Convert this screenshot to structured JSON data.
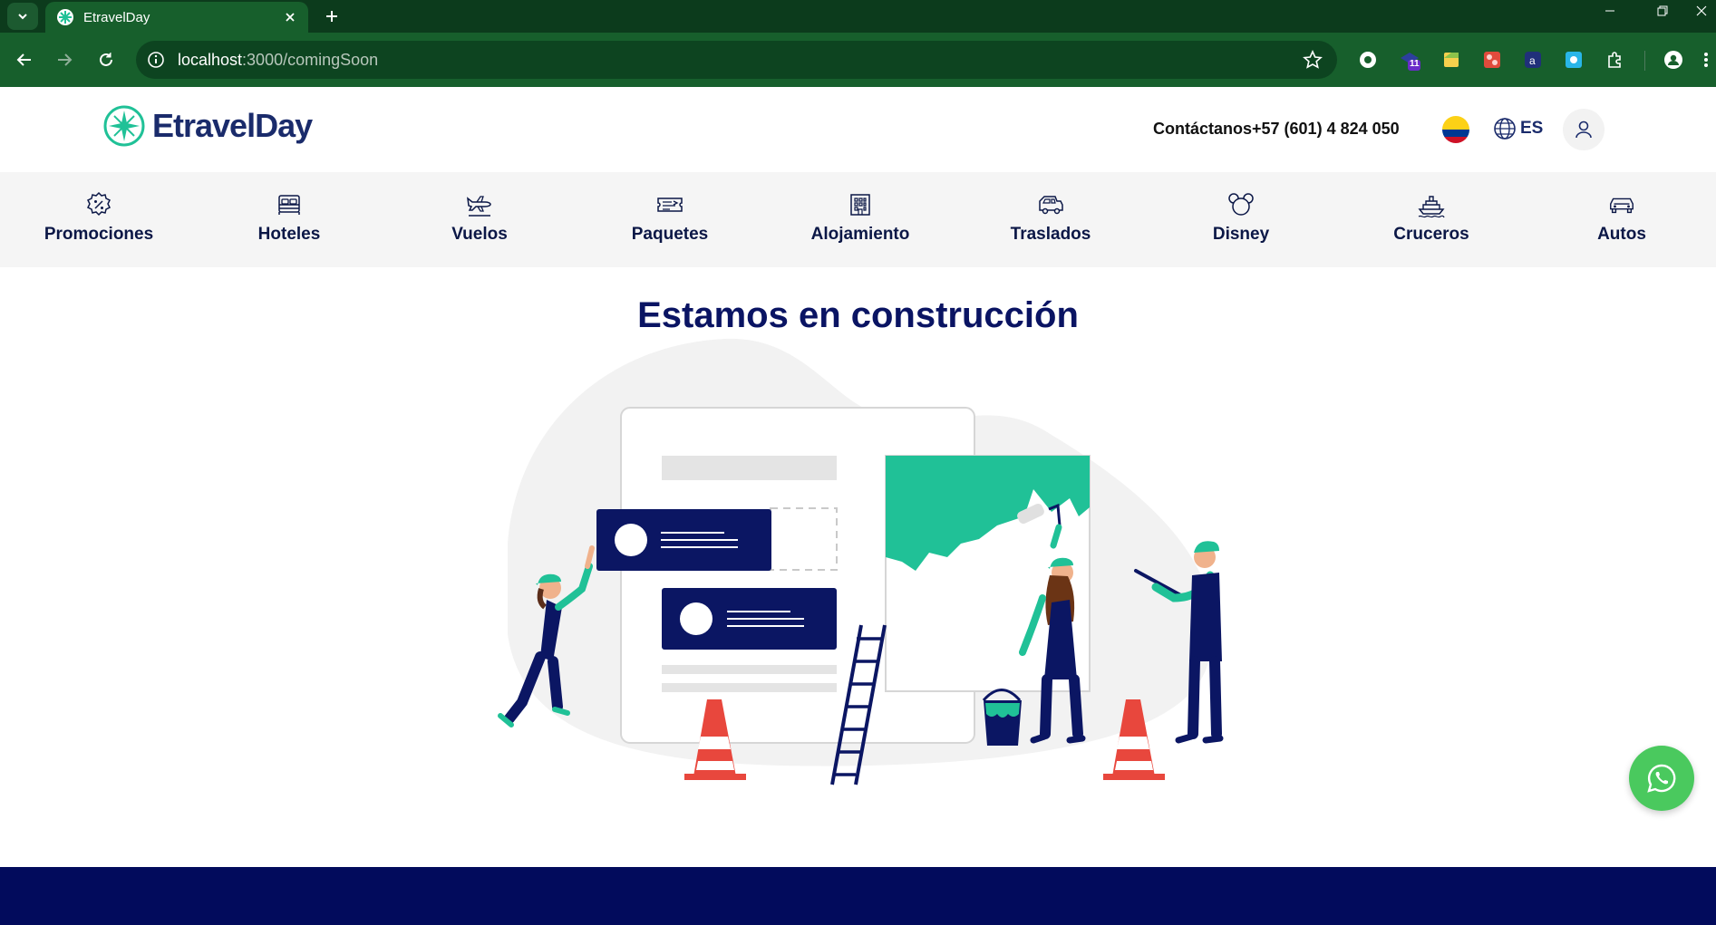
{
  "browser": {
    "tab_title": "EtravelDay",
    "url_host": "localhost",
    "url_rest": ":3000/comingSoon",
    "extension_badge": "11"
  },
  "header": {
    "logo_text": "EtravelDay",
    "contact": "Contáctanos+57 (601) 4 824 050",
    "language": "ES"
  },
  "nav": {
    "items": [
      {
        "label": "Promociones",
        "icon": "percent-badge-icon"
      },
      {
        "label": "Hoteles",
        "icon": "bed-icon"
      },
      {
        "label": "Vuelos",
        "icon": "airplane-icon"
      },
      {
        "label": "Paquetes",
        "icon": "ticket-icon"
      },
      {
        "label": "Alojamiento",
        "icon": "building-icon"
      },
      {
        "label": "Traslados",
        "icon": "van-icon"
      },
      {
        "label": "Disney",
        "icon": "mouse-ears-icon"
      },
      {
        "label": "Cruceros",
        "icon": "ship-icon"
      },
      {
        "label": "Autos",
        "icon": "car-icon"
      }
    ]
  },
  "main": {
    "title": "Estamos en construcción"
  },
  "colors": {
    "chrome_dark": "#0c3b1c",
    "chrome": "#175f2c",
    "brand_navy": "#0a1463",
    "brand_teal": "#20c197",
    "footer": "#020b5c",
    "whatsapp": "#4ac95e"
  }
}
